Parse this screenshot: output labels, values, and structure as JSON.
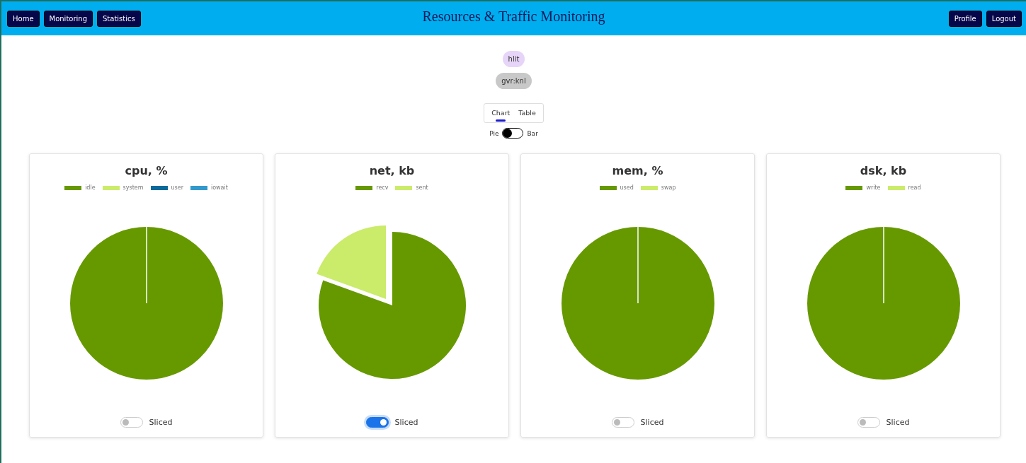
{
  "header": {
    "title": "Resources & Traffic Monitoring",
    "left_buttons": [
      "Home",
      "Monitoring",
      "Statistics"
    ],
    "right_buttons": [
      "Profile",
      "Logout"
    ]
  },
  "chips": [
    {
      "label": "hlit",
      "kind": "user"
    },
    {
      "label": "gvr:knl",
      "kind": "host"
    }
  ],
  "view_tabs": [
    {
      "label": "Chart",
      "selected": true
    },
    {
      "label": "Table",
      "selected": false
    }
  ],
  "chart_type_switch": {
    "left_label": "Pie",
    "right_label": "Bar",
    "on": false
  },
  "cards": [
    {
      "title": "cpu, %",
      "legend": [
        {
          "label": "idle",
          "color": "#669900"
        },
        {
          "label": "system",
          "color": "#cbeb6b"
        },
        {
          "label": "user",
          "color": "#0b6a9a"
        },
        {
          "label": "iowait",
          "color": "#3399cc"
        }
      ],
      "pie": {
        "kind": "whole"
      },
      "sliced": false,
      "switch_label": "Sliced"
    },
    {
      "title": "net, kb",
      "legend": [
        {
          "label": "recv",
          "color": "#669900"
        },
        {
          "label": "sent",
          "color": "#cbeb6b"
        }
      ],
      "pie": {
        "kind": "split"
      },
      "sliced": true,
      "switch_label": "Sliced"
    },
    {
      "title": "mem, %",
      "legend": [
        {
          "label": "used",
          "color": "#669900"
        },
        {
          "label": "swap",
          "color": "#cbeb6b"
        }
      ],
      "pie": {
        "kind": "whole"
      },
      "sliced": false,
      "switch_label": "Sliced"
    },
    {
      "title": "dsk, kb",
      "legend": [
        {
          "label": "write",
          "color": "#669900"
        },
        {
          "label": "read",
          "color": "#cbeb6b"
        }
      ],
      "pie": {
        "kind": "whole"
      },
      "sliced": false,
      "switch_label": "Sliced"
    }
  ]
}
